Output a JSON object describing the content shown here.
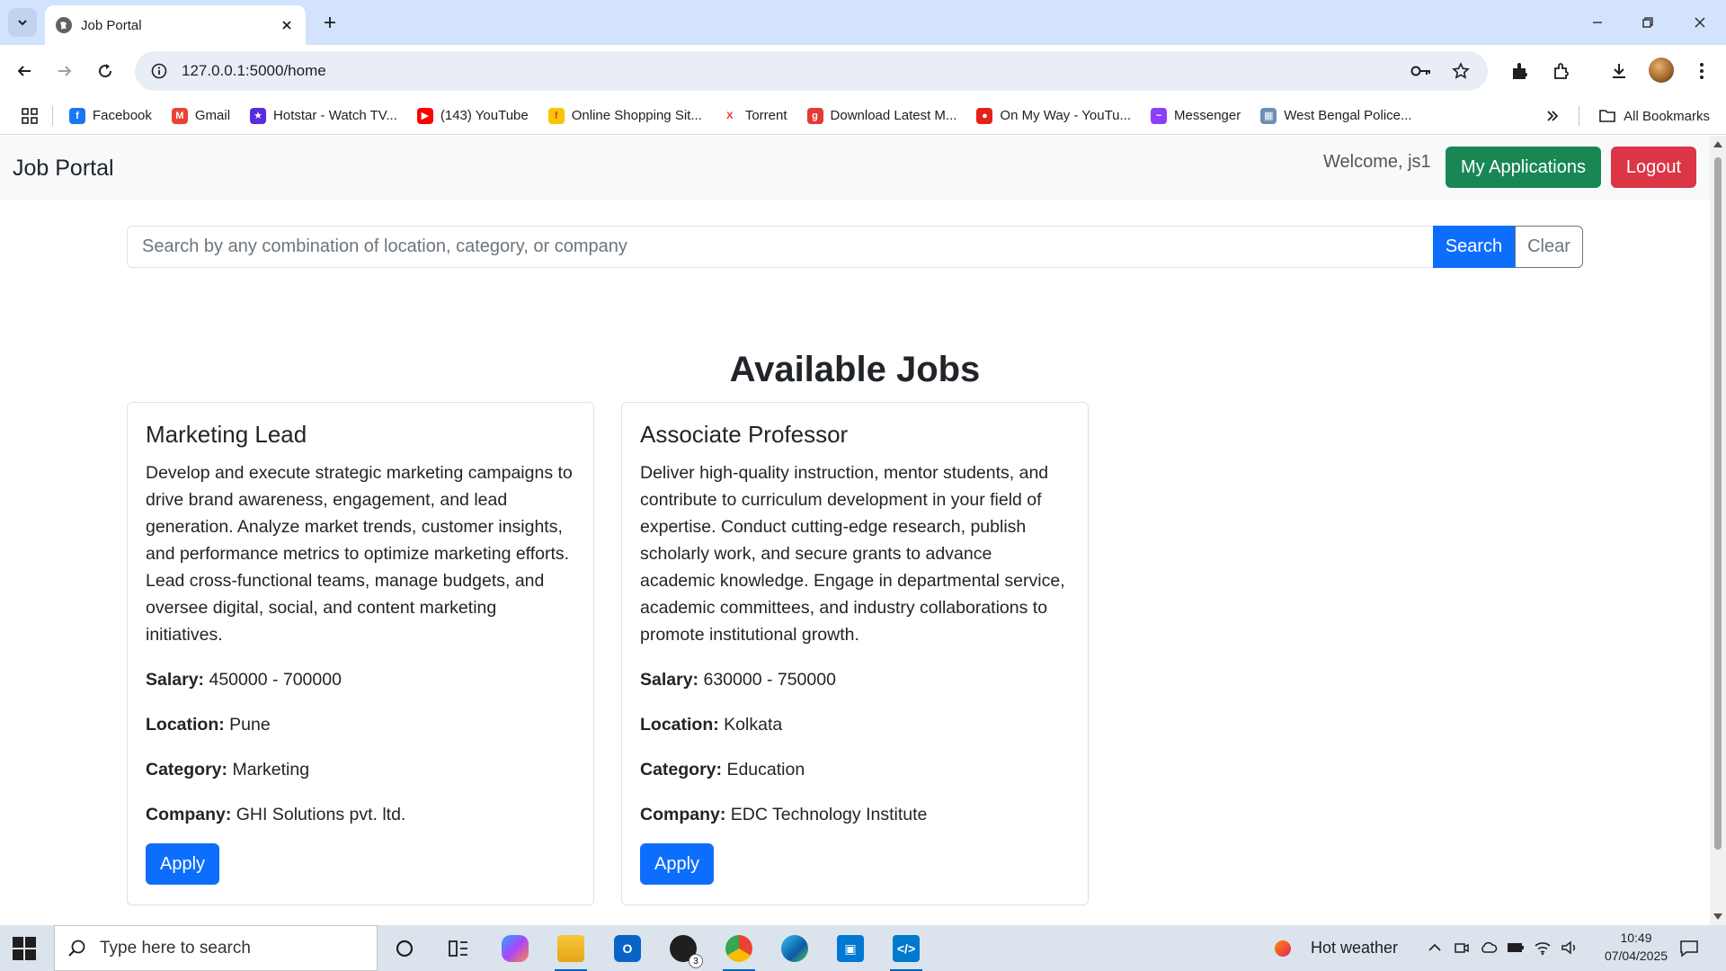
{
  "browser": {
    "tab_title": "Job Portal",
    "url": "127.0.0.1:5000/home",
    "bookmarks": [
      {
        "label": "Facebook",
        "color": "#1877f2",
        "glyph": "f"
      },
      {
        "label": "Gmail",
        "color": "#ea4335",
        "glyph": "M"
      },
      {
        "label": "Hotstar - Watch TV...",
        "color": "#5b2be0",
        "glyph": "★"
      },
      {
        "label": "(143) YouTube",
        "color": "#ff0000",
        "glyph": "▶"
      },
      {
        "label": "Online Shopping Sit...",
        "color": "#f7c600",
        "glyph": "f"
      },
      {
        "label": "Torrent",
        "color": "#ffffff",
        "glyph": "X"
      },
      {
        "label": "Download Latest M...",
        "color": "#e53935",
        "glyph": "g"
      },
      {
        "label": "On My Way - YouTu...",
        "color": "#e62117",
        "glyph": "●"
      },
      {
        "label": "Messenger",
        "color": "#8a3ffc",
        "glyph": "~"
      },
      {
        "label": "West Bengal Police...",
        "color": "#6d8fb5",
        "glyph": "▦"
      }
    ],
    "all_bookmarks": "All Bookmarks"
  },
  "navbar": {
    "brand": "Job Portal",
    "welcome": "Welcome, js1",
    "my_applications": "My Applications",
    "logout": "Logout"
  },
  "search": {
    "placeholder": "Search by any combination of location, category, or company",
    "search_label": "Search",
    "clear_label": "Clear"
  },
  "section_title": "Available Jobs",
  "labels": {
    "salary": "Salary:",
    "location": "Location:",
    "category": "Category:",
    "company": "Company:",
    "apply": "Apply"
  },
  "jobs": [
    {
      "title": "Marketing Lead",
      "description": "Develop and execute strategic marketing campaigns to drive brand awareness, engagement, and lead generation. Analyze market trends, customer insights, and performance metrics to optimize marketing efforts. Lead cross-functional teams, manage budgets, and oversee digital, social, and content marketing initiatives.",
      "salary": "450000 - 700000",
      "location": "Pune",
      "category": "Marketing",
      "company": "GHI Solutions pvt. ltd."
    },
    {
      "title": "Associate Professor",
      "description": "Deliver high-quality instruction, mentor students, and contribute to curriculum development in your field of expertise. Conduct cutting-edge research, publish scholarly work, and secure grants to advance academic knowledge. Engage in departmental service, academic committees, and industry collaborations to promote institutional growth.",
      "salary": "630000 - 750000",
      "location": "Kolkata",
      "category": "Education",
      "company": "EDC Technology Institute"
    }
  ],
  "taskbar": {
    "search_placeholder": "Type here to search",
    "whatsapp_badge": "3",
    "weather": "Hot weather",
    "time": "10:49",
    "date": "07/04/2025"
  },
  "colors": {
    "success": "#198754",
    "danger": "#dc3545",
    "primary": "#0d6efd",
    "tabstrip": "#d3e3fd"
  }
}
